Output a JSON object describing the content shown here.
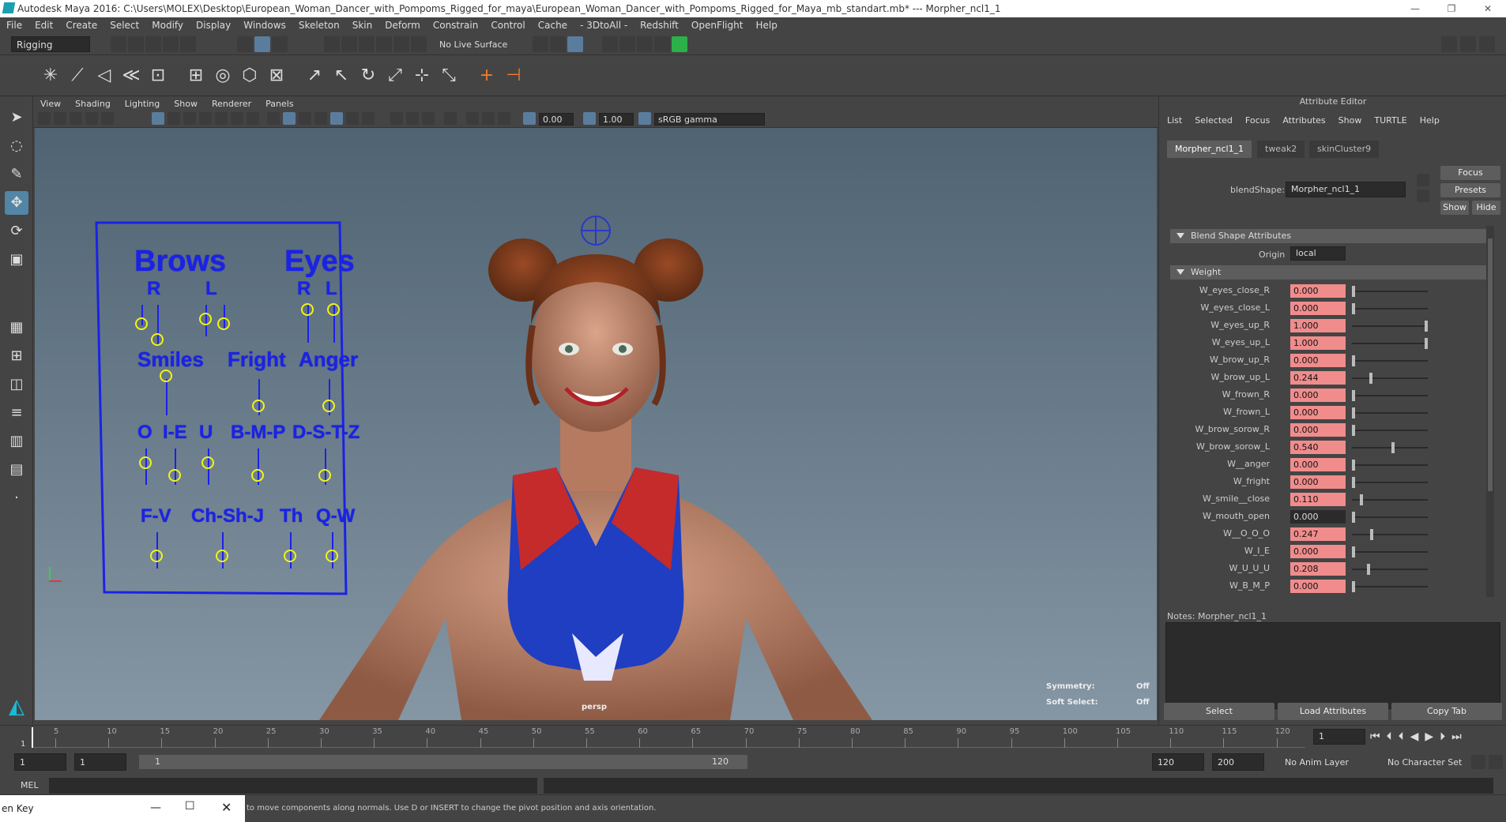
{
  "window": {
    "title": "Autodesk Maya 2016: C:\\Users\\MOLEX\\Desktop\\European_Woman_Dancer_with_Pompoms_Rigged_for_maya\\European_Woman_Dancer_with_Pompoms_Rigged_for_Maya_mb_standart.mb*  ---  Morpher_ncl1_1",
    "controls": [
      "—",
      "❐",
      "✕"
    ]
  },
  "menus": [
    "File",
    "Edit",
    "Create",
    "Select",
    "Modify",
    "Display",
    "Windows",
    "Skeleton",
    "Skin",
    "Deform",
    "Constrain",
    "Control",
    "Cache",
    "- 3DtoAll -",
    "Redshift",
    "OpenFlight",
    "Help"
  ],
  "status": {
    "mode": "Rigging",
    "live_surface": "No Live Surface"
  },
  "panel_menu": [
    "View",
    "Shading",
    "Lighting",
    "Show",
    "Renderer",
    "Panels"
  ],
  "viewbar": {
    "exposure": "0.00",
    "gamma": "1.00",
    "colorspace": "sRGB gamma"
  },
  "viewport": {
    "camera": "persp",
    "symmetry_label": "Symmetry:",
    "symmetry_value": "Off",
    "soft_select_label": "Soft Select:",
    "soft_select_value": "Off"
  },
  "rig": {
    "brows": "Brows",
    "eyes": "Eyes",
    "r1": "R",
    "l1": "L",
    "r2": "R",
    "l2": "L",
    "smiles": "Smiles",
    "fright": "Fright",
    "anger": "Anger",
    "o": "O",
    "ie": "I-E",
    "u": "U",
    "bmp": "B-M-P",
    "dstz": "D-S-T-Z",
    "fv": "F-V",
    "chshj": "Ch-Sh-J",
    "th": "Th",
    "qw": "Q-W"
  },
  "attr": {
    "header": "Attribute Editor",
    "menu": [
      "List",
      "Selected",
      "Focus",
      "Attributes",
      "Show",
      "TURTLE",
      "Help"
    ],
    "tabs": [
      "Morpher_ncl1_1",
      "tweak2",
      "skinCluster9"
    ],
    "blendshape_label": "blendShape:",
    "blendshape_value": "Morpher_ncl1_1",
    "focus": "Focus",
    "presets": "Presets",
    "show": "Show",
    "hide": "Hide",
    "section1": "Blend Shape Attributes",
    "origin_label": "Origin",
    "origin_value": "local",
    "section2": "Weight",
    "weights": [
      {
        "name": "W_eyes_close_R",
        "value": "0.000",
        "pos": 0
      },
      {
        "name": "W_eyes_close_L",
        "value": "0.000",
        "pos": 0
      },
      {
        "name": "W_eyes_up_R",
        "value": "1.000",
        "pos": 1
      },
      {
        "name": "W_eyes_up_L",
        "value": "1.000",
        "pos": 1
      },
      {
        "name": "W_brow_up_R",
        "value": "0.000",
        "pos": 0
      },
      {
        "name": "W_brow_up_L",
        "value": "0.244",
        "pos": 0.244
      },
      {
        "name": "W_frown_R",
        "value": "0.000",
        "pos": 0
      },
      {
        "name": "W_frown_L",
        "value": "0.000",
        "pos": 0
      },
      {
        "name": "W_brow_sorow_R",
        "value": "0.000",
        "pos": 0
      },
      {
        "name": "W_brow_sorow_L",
        "value": "0.540",
        "pos": 0.54
      },
      {
        "name": "W__anger",
        "value": "0.000",
        "pos": 0
      },
      {
        "name": "W_fright",
        "value": "0.000",
        "pos": 0
      },
      {
        "name": "W_smile__close",
        "value": "0.110",
        "pos": 0.11
      },
      {
        "name": "W_mouth_open",
        "value": "0.000",
        "pos": 0,
        "dark": true
      },
      {
        "name": "W__O_O_O",
        "value": "0.247",
        "pos": 0.247
      },
      {
        "name": "W_I_E",
        "value": "0.000",
        "pos": 0
      },
      {
        "name": "W_U_U_U",
        "value": "0.208",
        "pos": 0.208
      },
      {
        "name": "W_B_M_P",
        "value": "0.000",
        "pos": 0
      }
    ],
    "notes_label": "Notes:  Morpher_ncl1_1",
    "btn_select": "Select",
    "btn_load": "Load Attributes",
    "btn_copy": "Copy Tab"
  },
  "timeline": {
    "ticks": [
      "5",
      "10",
      "15",
      "20",
      "25",
      "30",
      "35",
      "40",
      "45",
      "50",
      "55",
      "60",
      "65",
      "70",
      "75",
      "80",
      "85",
      "90",
      "95",
      "100",
      "105",
      "110",
      "115",
      "120"
    ],
    "start_marker": "1",
    "current": "1"
  },
  "range": {
    "start": "1",
    "inner_start": "1",
    "slider_start": "1",
    "slider_end": "120",
    "end": "120",
    "max": "200",
    "anim_layer": "No Anim Layer",
    "char_set": "No Character Set"
  },
  "cmd": {
    "label": "MEL"
  },
  "help": {
    "floating": "en Key",
    "text": "to move components along normals. Use D or INSERT to change the pivot position and axis orientation."
  }
}
